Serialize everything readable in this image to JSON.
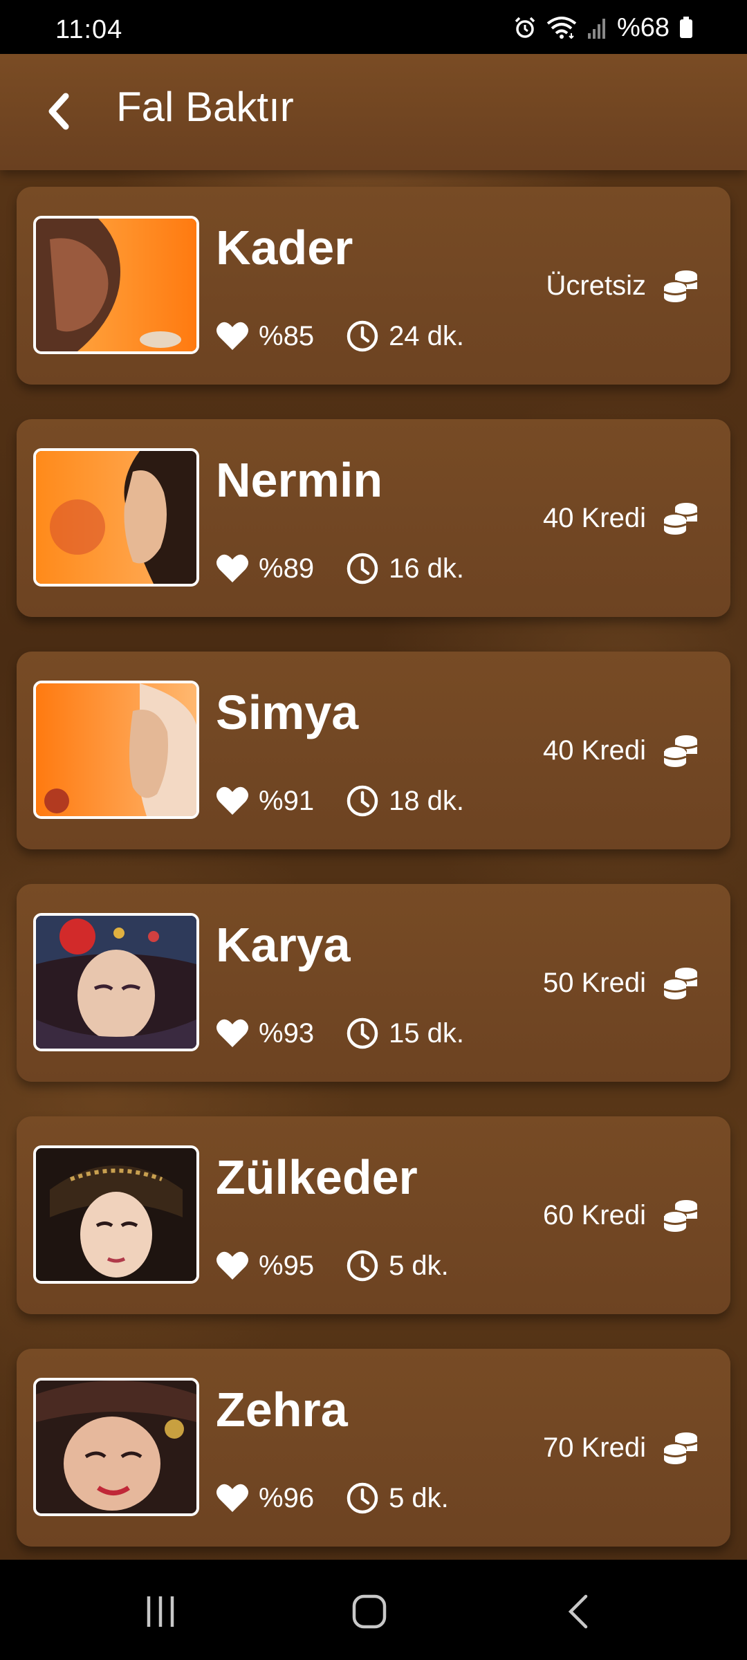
{
  "status_bar": {
    "time": "11:04",
    "battery_text": "%68",
    "icons": [
      "alarm-icon",
      "wifi-icon",
      "signal-icon",
      "battery-icon"
    ]
  },
  "header": {
    "back_icon": "chevron-left-icon",
    "title": "Fal Baktır"
  },
  "readers": [
    {
      "name": "Kader",
      "rating": "%85",
      "duration": "24 dk.",
      "price": "Ücretsiz"
    },
    {
      "name": "Nermin",
      "rating": "%89",
      "duration": "16 dk.",
      "price": "40 Kredi"
    },
    {
      "name": "Simya",
      "rating": "%91",
      "duration": "18 dk.",
      "price": "40 Kredi"
    },
    {
      "name": "Karya",
      "rating": "%93",
      "duration": "15 dk.",
      "price": "50 Kredi"
    },
    {
      "name": "Zülkeder",
      "rating": "%95",
      "duration": "5 dk.",
      "price": "60 Kredi"
    },
    {
      "name": "Zehra",
      "rating": "%96",
      "duration": "5 dk.",
      "price": "70 Kredi"
    }
  ],
  "card_icons": {
    "rating": "heart-icon",
    "duration": "clock-icon",
    "price": "coins-icon"
  },
  "nav_bar": {
    "icons": [
      "recent-apps-icon",
      "home-icon",
      "back-icon"
    ]
  },
  "colors": {
    "header": "#6f4421",
    "card": "#744a24",
    "background": "#4a2c13",
    "photo_accent": "#f07a18"
  }
}
